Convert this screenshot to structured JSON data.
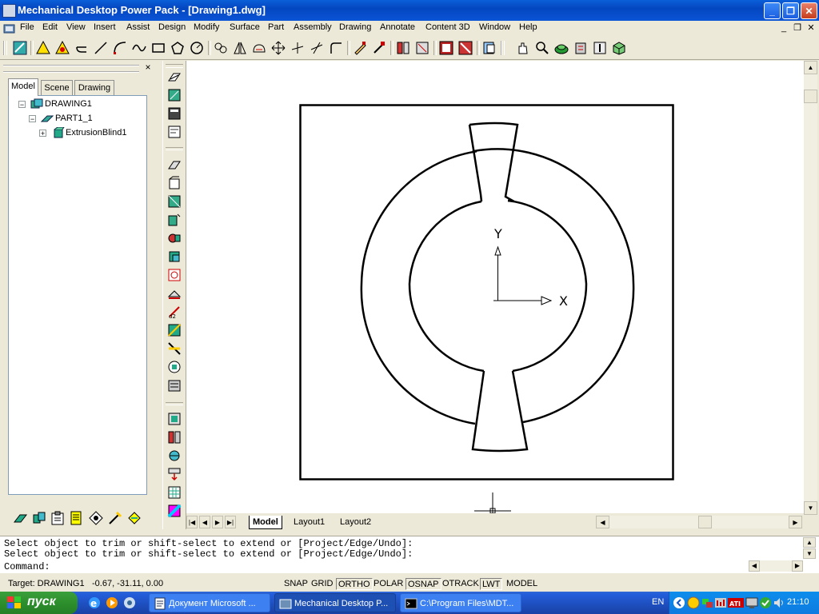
{
  "window": {
    "title": "Mechanical Desktop Power Pack - [Drawing1.dwg]",
    "buttons": [
      "_",
      "❐",
      "✕"
    ]
  },
  "menu": {
    "items": [
      "File",
      "Edit",
      "View",
      "Insert",
      "Assist",
      "Design",
      "Modify",
      "Surface",
      "Part",
      "Assembly",
      "Drawing",
      "Annotate",
      "Content 3D",
      "Window",
      "Help"
    ],
    "doc_buttons": [
      "_",
      "❐",
      "✕"
    ]
  },
  "toolbar": {
    "buttons": [
      "new-sketch-icon",
      "warning-triangle-icon",
      "warning-triangle-icon",
      "undo-arc-icon",
      "line-icon",
      "arc-icon",
      "spline-icon",
      "rectangle-icon",
      "polygon-icon",
      "clock-icon",
      "trim-icon",
      "mirror-icon",
      "fillet-icon",
      "move-icon",
      "extend-icon",
      "offset-icon",
      "corner-icon",
      "pencil-icon",
      "erase-icon",
      "block-icon",
      "block-icon",
      "group-icon",
      "hand-icon",
      "zoom-icon",
      "render-icon",
      "save-icon",
      "layer-icon",
      "box-icon"
    ]
  },
  "browser": {
    "tabs": [
      "Model",
      "Scene",
      "Drawing"
    ],
    "active_tab": "Model",
    "tree": [
      {
        "label": "DRAWING1",
        "expander": "−",
        "icon": "drawing-icon"
      },
      {
        "label": "PART1_1",
        "expander": "−",
        "icon": "part-icon"
      },
      {
        "label": "ExtrusionBlind1",
        "expander": "+",
        "icon": "extrusion-icon"
      }
    ],
    "bottom_buttons": [
      "sketch-icon",
      "assembly-icon",
      "clipboard-icon",
      "notes-icon",
      "view-icon",
      "pen-icon",
      "settings-icon"
    ],
    "close": "×"
  },
  "vertical_toolbar": {
    "buttons": [
      "vt-icon-1",
      "vt-icon-2",
      "vt-icon-3",
      "vt-icon-4",
      "vt-icon-5",
      "vt-icon-6",
      "vt-icon-7",
      "vt-icon-8",
      "vt-icon-9",
      "vt-icon-10",
      "vt-icon-11",
      "vt-icon-12",
      "vt-icon-13",
      "vt-icon-14",
      "vt-icon-15",
      "vt-icon-16",
      "vt-icon-17",
      "vt-icon-18",
      "vt-icon-19",
      "vt-icon-20",
      "vt-icon-21",
      "vt-icon-22",
      "vt-icon-23",
      "vt-icon-24"
    ]
  },
  "drawing": {
    "axis_y_label": "Y",
    "axis_x_label": "X"
  },
  "layout_tabs": [
    "Model",
    "Layout1",
    "Layout2"
  ],
  "command": {
    "history": [
      "Select object to trim or shift-select to extend or [Project/Edge/Undo]:",
      "Select object to trim or shift-select to extend or [Project/Edge/Undo]:"
    ],
    "prompt": "Command:"
  },
  "status": {
    "target": "Target: DRAWING1",
    "coords": "-0.67, -31.11, 0.00",
    "toggles": [
      "SNAP",
      "GRID",
      "ORTHO",
      "POLAR",
      "OSNAP",
      "OTRACK",
      "LWT",
      "MODEL"
    ],
    "active_toggles": [
      "ORTHO",
      "OSNAP",
      "LWT"
    ]
  },
  "taskbar": {
    "start": "пуск",
    "tasks": [
      {
        "label": "Документ Microsoft ...",
        "active": false
      },
      {
        "label": "Mechanical Desktop P...",
        "active": true
      },
      {
        "label": "C:\\Program Files\\MDT...",
        "active": false
      }
    ],
    "lang": "EN",
    "clock": "21:10"
  },
  "colors": {
    "titlebar": "#0a54d6",
    "taskbar": "#245edb",
    "start": "#2c8f2c",
    "canvas": "#ffffff"
  }
}
